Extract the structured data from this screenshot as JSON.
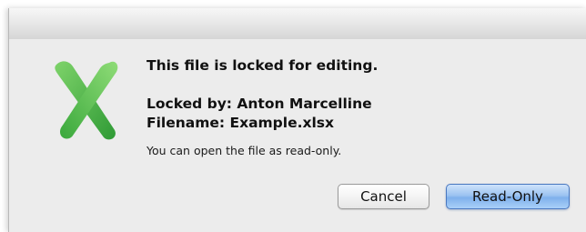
{
  "dialog": {
    "app_icon": "excel-x-icon",
    "headline": "This file is locked for editing.",
    "locked_by": "Locked by: Anton Marcelline",
    "filename": "Filename: Example.xlsx",
    "info": "You can open the file as read-only."
  },
  "buttons": {
    "cancel_label": "Cancel",
    "readonly_label": "Read-Only"
  },
  "colors": {
    "dialog_bg": "#ececec",
    "icon_green": "#3fae3f",
    "default_button_blue": "#8fbbf0"
  }
}
